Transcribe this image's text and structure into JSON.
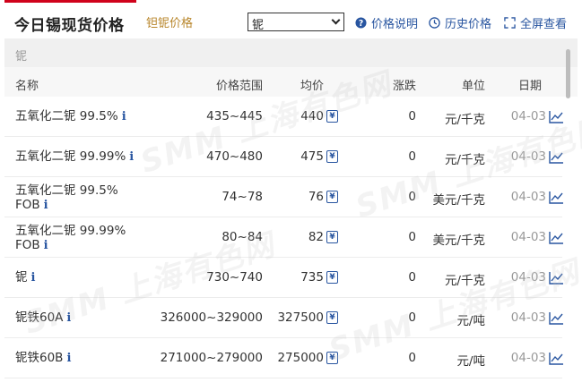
{
  "header": {
    "main_tab": "今日锡现货价格",
    "sub_tab": "钽铌价格",
    "select": {
      "value": "铌"
    },
    "actions": [
      {
        "label": "价格说明",
        "icon": "question-circle-icon"
      },
      {
        "label": "历史价格",
        "icon": "clock-icon"
      },
      {
        "label": "全屏查看",
        "icon": "fullscreen-icon"
      }
    ]
  },
  "category_label": "铌",
  "columns": [
    "名称",
    "价格范围",
    "均价",
    "涨跌",
    "单位",
    "日期"
  ],
  "rows": [
    {
      "name_line1": "五氧化二铌 99.5%",
      "name_line2": "",
      "range": "435~445",
      "avg": "440",
      "change": "0",
      "unit": "元/千克",
      "date": "04-03"
    },
    {
      "name_line1": "五氧化二铌 99.99%",
      "name_line2": "",
      "range": "470~480",
      "avg": "475",
      "change": "0",
      "unit": "元/千克",
      "date": "04-03"
    },
    {
      "name_line1": "五氧化二铌 99.5%",
      "name_line2": "FOB",
      "range": "74~78",
      "avg": "76",
      "change": "0",
      "unit": "美元/千克",
      "date": "04-03"
    },
    {
      "name_line1": "五氧化二铌 99.99%",
      "name_line2": "FOB",
      "range": "80~84",
      "avg": "82",
      "change": "0",
      "unit": "美元/千克",
      "date": "04-03"
    },
    {
      "name_line1": "铌",
      "name_line2": "",
      "range": "730~740",
      "avg": "735",
      "change": "0",
      "unit": "元/千克",
      "date": "04-03"
    },
    {
      "name_line1": "铌铁60A",
      "name_line2": "",
      "range": "326000~329000",
      "avg": "327500",
      "change": "0",
      "unit": "元/吨",
      "date": "04-03"
    },
    {
      "name_line1": "铌铁60B",
      "name_line2": "",
      "range": "271000~279000",
      "avg": "275000",
      "change": "0",
      "unit": "元/吨",
      "date": "04-03"
    }
  ],
  "info_glyph": "i",
  "yuan_glyph": "¥",
  "watermark_text": "SMM 上海有色网",
  "colors": {
    "accent_red": "#d0021b",
    "gold": "#b8862b",
    "link_blue": "#2855a0"
  }
}
